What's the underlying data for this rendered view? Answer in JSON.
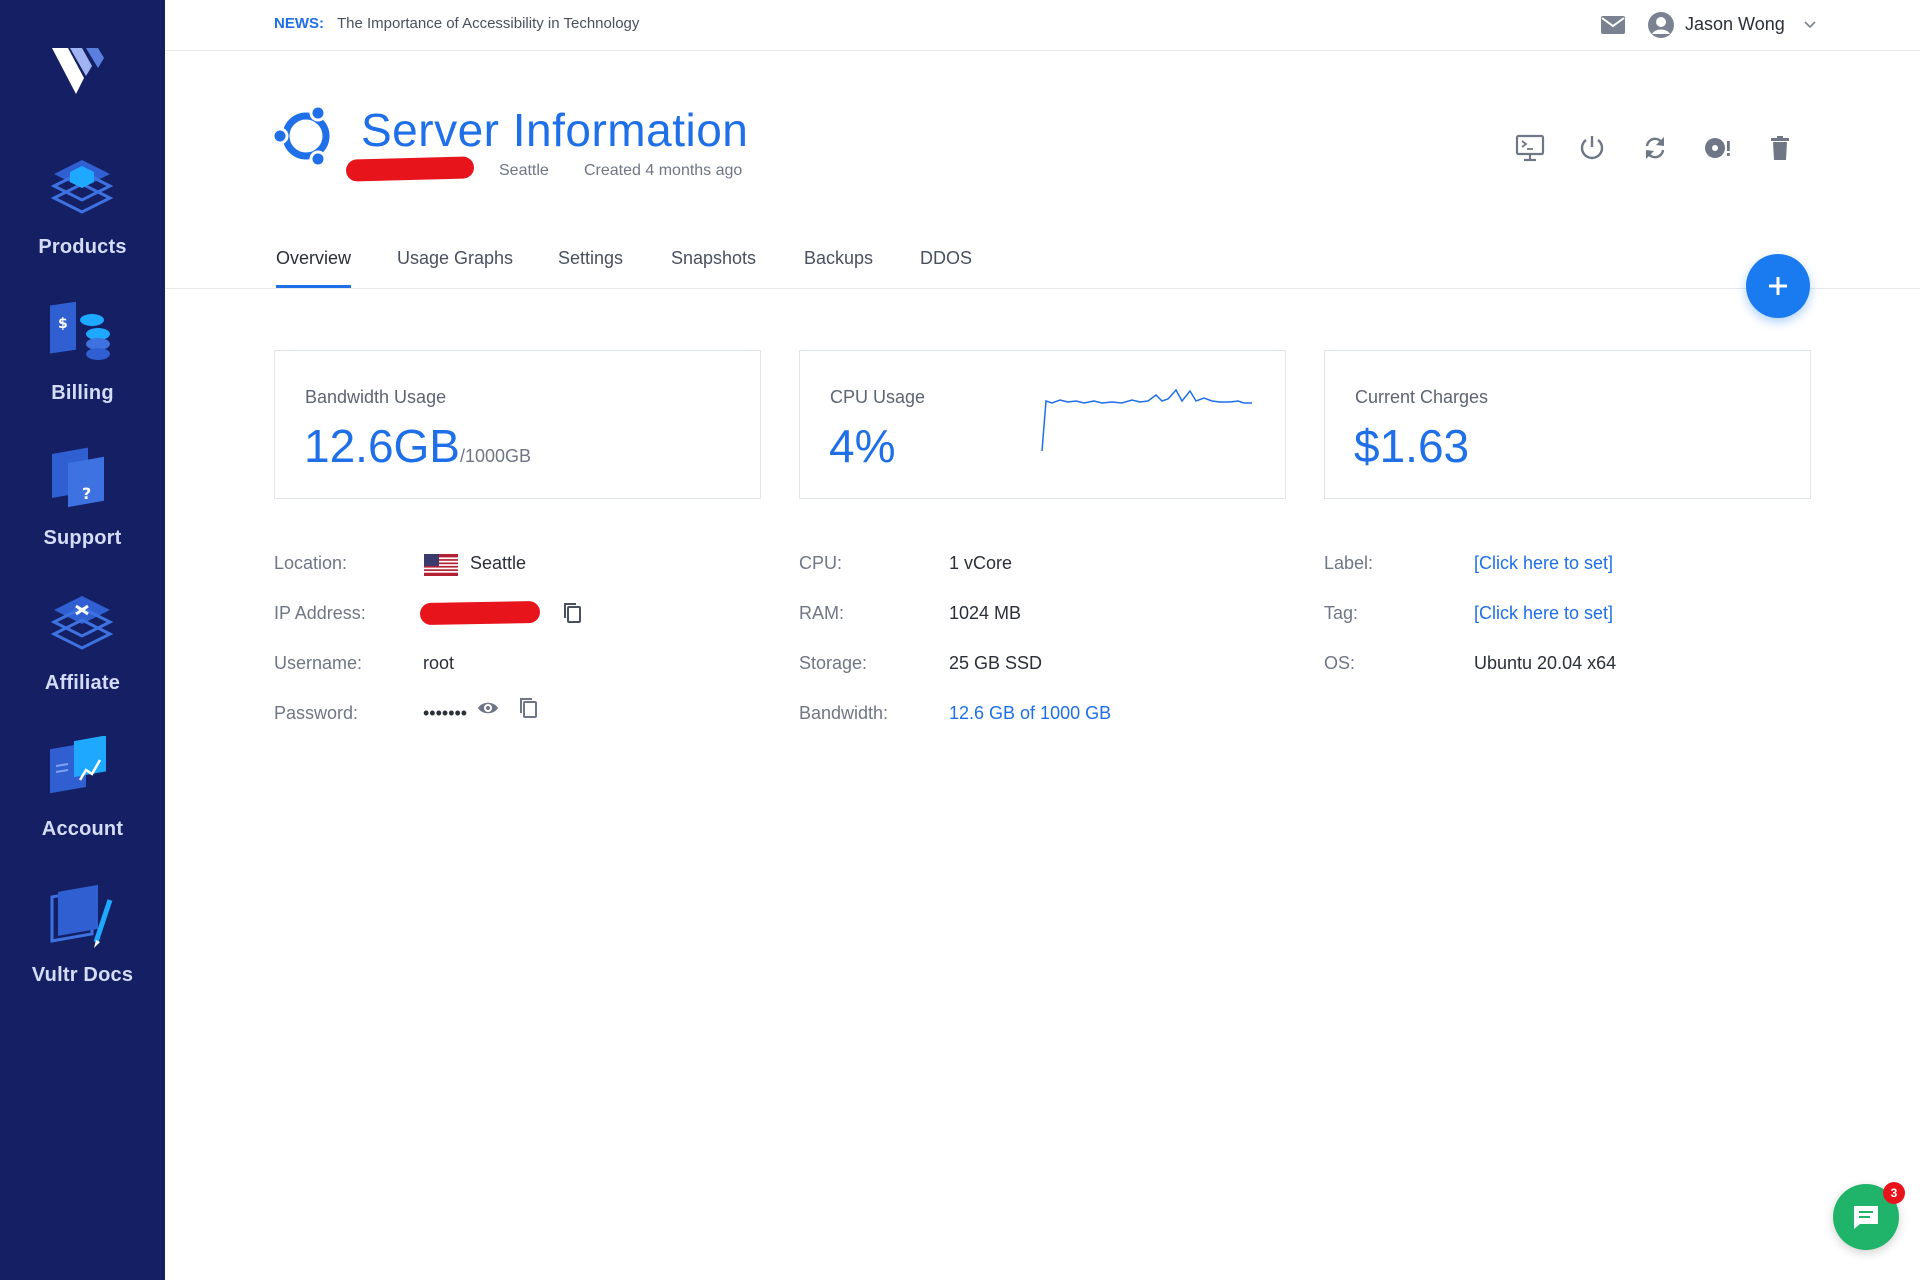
{
  "news": {
    "tag": "NEWS:",
    "text": "The Importance of Accessibility in Technology"
  },
  "user": {
    "name": "Jason Wong"
  },
  "sidebar": {
    "items": [
      {
        "label": "Products",
        "icon": "products-icon"
      },
      {
        "label": "Billing",
        "icon": "billing-icon"
      },
      {
        "label": "Support",
        "icon": "support-icon"
      },
      {
        "label": "Affiliate",
        "icon": "affiliate-icon"
      },
      {
        "label": "Account",
        "icon": "account-icon"
      },
      {
        "label": "Vultr Docs",
        "icon": "docs-icon"
      }
    ]
  },
  "header": {
    "title": "Server Information",
    "location": "Seattle",
    "created": "Created 4 months ago"
  },
  "tabs": [
    "Overview",
    "Usage Graphs",
    "Settings",
    "Snapshots",
    "Backups",
    "DDOS"
  ],
  "cards": {
    "bandwidth": {
      "label": "Bandwidth Usage",
      "value": "12.6GB",
      "unit": "/1000GB"
    },
    "cpu": {
      "label": "CPU Usage",
      "value": "4%"
    },
    "charges": {
      "label": "Current Charges",
      "value": "$1.63"
    }
  },
  "details": {
    "left": {
      "location_label": "Location:",
      "location_value": "Seattle",
      "ip_label": "IP Address:",
      "username_label": "Username:",
      "username_value": "root",
      "password_label": "Password:",
      "password_value": "•••••••"
    },
    "middle": {
      "cpu_label": "CPU:",
      "cpu_value": "1 vCore",
      "ram_label": "RAM:",
      "ram_value": "1024 MB",
      "storage_label": "Storage:",
      "storage_value": "25 GB SSD",
      "bandwidth_label": "Bandwidth:",
      "bandwidth_value": "12.6 GB of 1000 GB"
    },
    "right": {
      "label_label": "Label:",
      "label_value": "[Click here to set]",
      "tag_label": "Tag:",
      "tag_value": "[Click here to set]",
      "os_label": "OS:",
      "os_value": "Ubuntu 20.04 x64"
    }
  },
  "chat": {
    "badge": "3"
  },
  "colors": {
    "brand": "#1e6fe8",
    "sidebar": "#142063",
    "chat": "#1fb46a",
    "badge": "#e8141c"
  }
}
